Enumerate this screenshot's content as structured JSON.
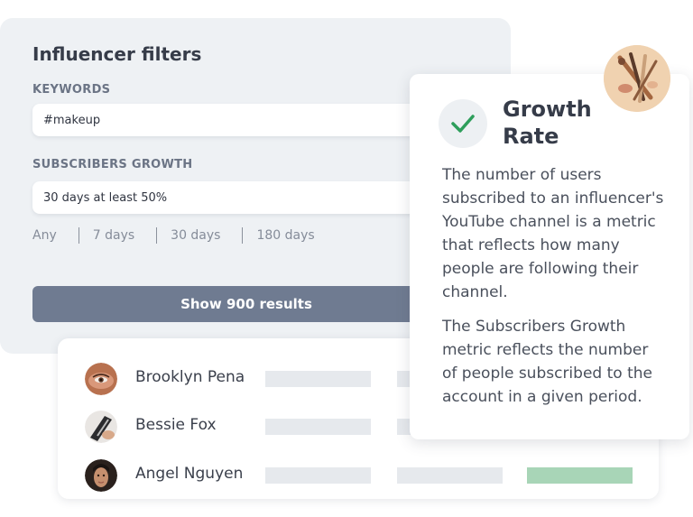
{
  "filters": {
    "title": "Influencer filters",
    "keywords_label": "KEYWORDS",
    "keywords_value": "#makeup",
    "growth_label": "SUBSCRIBERS GROWTH",
    "growth_value": "30 days at least 50%",
    "periods": [
      "Any",
      "7 days",
      "30 days",
      "180 days"
    ],
    "show_button": "Show 900 results"
  },
  "popup": {
    "title_line1": "Growth",
    "title_line2": "Rate",
    "paragraph1": "The number of users subscribed to an influencer's YouTube channel is a metric that reflects how many people are following their channel.",
    "paragraph2": "The Subscribers Growth metric reflects the number of people subscribed to the account in a given period.",
    "check_color": "#2e9e5b"
  },
  "results": {
    "rows": [
      {
        "name": "Brooklyn Pena",
        "avatar": "avatar-brooklyn"
      },
      {
        "name": "Bessie Fox",
        "avatar": "avatar-bessie"
      },
      {
        "name": "Angel Nguyen",
        "avatar": "avatar-angel"
      }
    ]
  },
  "colors": {
    "panel_bg": "#eef1f4",
    "button_bg": "#6f7b91",
    "bar_gray": "#e6e9ed",
    "bar_green": "#a8d5b7"
  }
}
